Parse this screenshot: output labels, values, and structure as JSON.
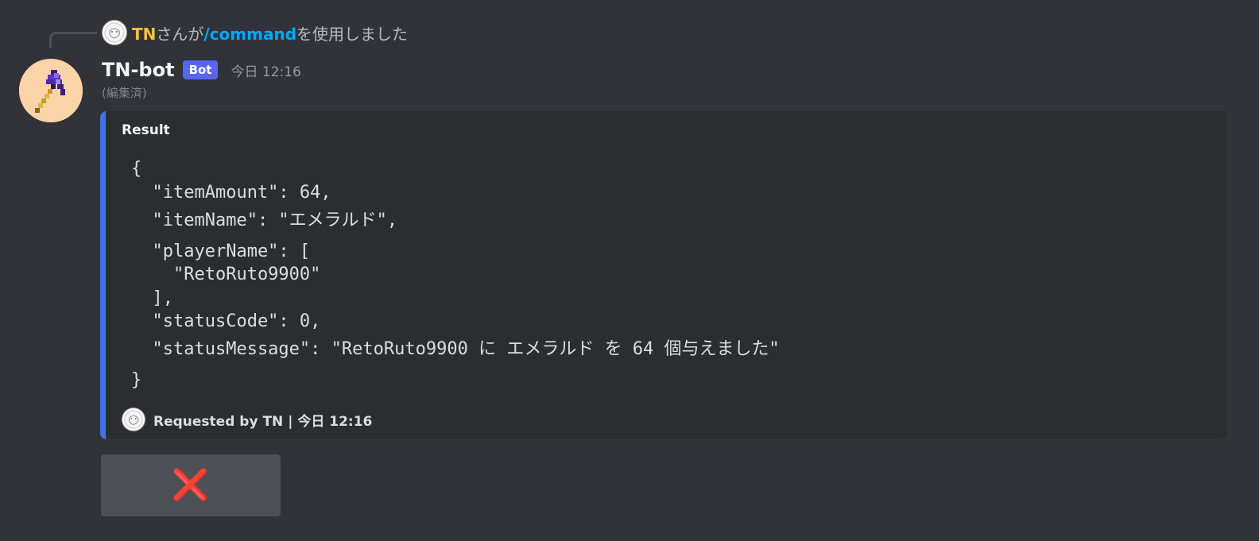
{
  "reply": {
    "user": "TN",
    "text_before": "さんが",
    "command": "/command",
    "text_after": "を使用しました"
  },
  "message": {
    "author": "TN-bot",
    "badge": "Bot",
    "timestamp": "今日 12:16",
    "edited": "(編集済)"
  },
  "embed": {
    "accent_color": "#4171e8",
    "title": "Result",
    "code_lines": [
      "{",
      "  \"itemAmount\": 64,",
      "  \"itemName\": \"エメラルド\",",
      "  \"playerName\": [",
      "    \"RetoRuto9900\"",
      "  ],",
      "  \"statusCode\": 0,",
      "  \"statusMessage\": \"RetoRuto9900 に エメラルド を 64 個与えました\"",
      "}"
    ],
    "footer": "Requested by TN | 今日 12:16"
  },
  "actions": {
    "close_icon": "x-icon",
    "close_symbol": "❌"
  },
  "colors": {
    "background": "#313338",
    "embed_background": "#2b2d31",
    "bot_badge": "#5865f2",
    "reply_user": "#f0c040",
    "command_link": "#00a8fc"
  }
}
